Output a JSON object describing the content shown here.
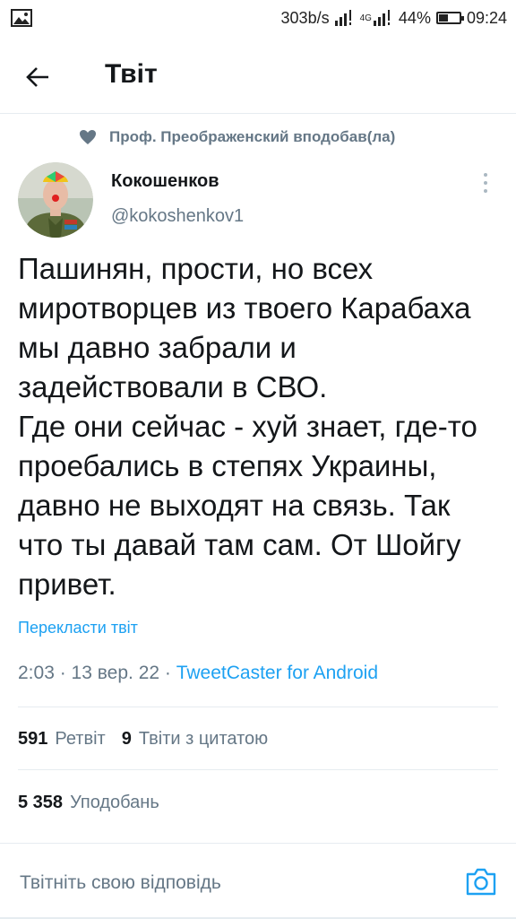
{
  "status_bar": {
    "speed": "303b/s",
    "network": "4G",
    "battery": "44%",
    "battery_level": 0.44,
    "time": "09:24"
  },
  "header": {
    "title": "Твіт"
  },
  "liked_by": {
    "text": "Проф. Преображенский вподобав(ла)"
  },
  "author": {
    "name": "Кокошенков",
    "handle": "@kokoshenkov1"
  },
  "tweet": {
    "text": "Пашинян, прости, но всех миротворцев из твоего Карабаха мы давно забрали и задействовали в СВО.\nГде они сейчас - хуй знает, где-то проебались в степях Украины, давно не выходят на связь. Так что ты давай там сам. От Шойгу привет.",
    "translate_label": "Перекласти твіт",
    "time": "2:03",
    "date": "13 вер. 22",
    "client": "TweetCaster for Android"
  },
  "stats": {
    "retweets_count": "591",
    "retweets_label": "Ретвіт",
    "quotes_count": "9",
    "quotes_label": "Твіти з цитатою",
    "likes_count": "5 358",
    "likes_label": "Уподобань"
  },
  "reply": {
    "placeholder": "Твітніть свою відповідь"
  },
  "colors": {
    "accent": "#1da1f2",
    "secondary_text": "#657786",
    "primary_text": "#14171a",
    "divider": "#e6ecf0"
  },
  "icons": {
    "back": "arrow-left-icon",
    "heart": "heart-icon",
    "more": "more-vertical-icon",
    "camera": "camera-icon"
  }
}
